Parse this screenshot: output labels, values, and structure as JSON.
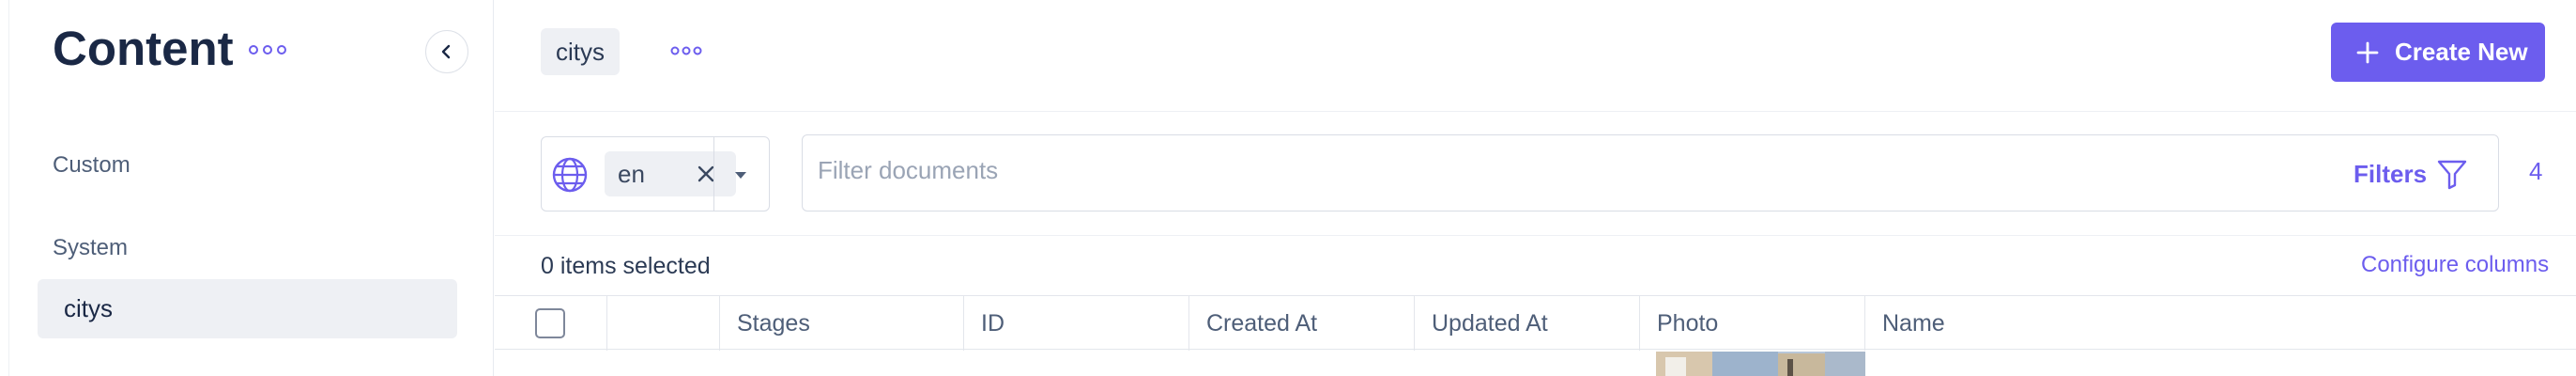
{
  "sidebar": {
    "title": "Content",
    "sections": [
      {
        "label": "Custom"
      },
      {
        "label": "System"
      }
    ],
    "items": [
      {
        "label": "citys",
        "active": true
      }
    ]
  },
  "header": {
    "breadcrumb": "citys",
    "create_label": "Create New"
  },
  "filters": {
    "locale": "en",
    "search_placeholder": "Filter documents",
    "filters_label": "Filters",
    "count": "4"
  },
  "selection": {
    "text": "0 items selected",
    "configure_label": "Configure columns"
  },
  "table": {
    "columns": [
      "",
      "",
      "Stages",
      "ID",
      "Created At",
      "Updated At",
      "Photo",
      "Name"
    ]
  },
  "colors": {
    "accent": "#6c5dee",
    "sidebar_active_bg": "#eef0f4",
    "text_primary": "#1a2845",
    "text_secondary": "#4e5e78"
  }
}
